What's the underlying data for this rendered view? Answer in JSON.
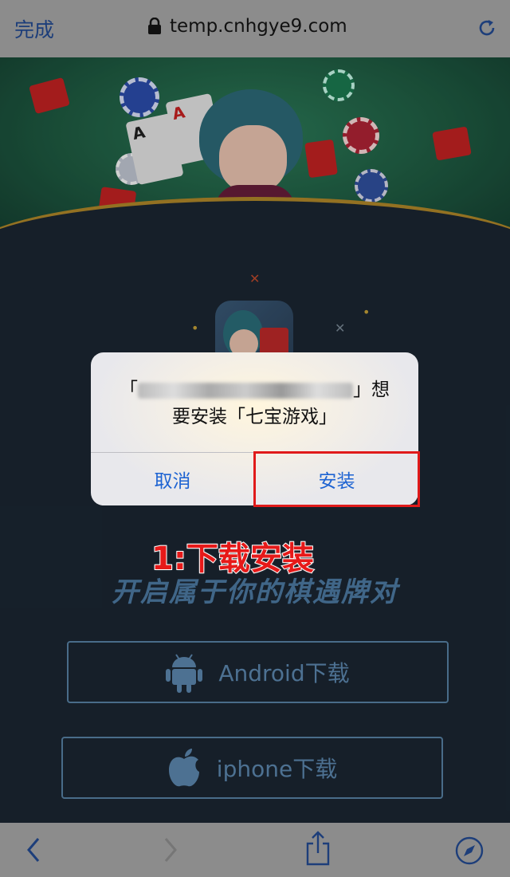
{
  "browser": {
    "done_label": "完成",
    "url": "temp.cnhgye9.com"
  },
  "page": {
    "slogan": "开启属于你的棋遇牌对",
    "android_label": "Android下载",
    "iphone_label": "iphone下载"
  },
  "dialog": {
    "line1_prefix": "「",
    "line1_suffix": "」想",
    "line2": "要安装「七宝游戏」",
    "cancel_label": "取消",
    "install_label": "安装"
  },
  "annotation": {
    "step_label": "1:下载安装"
  },
  "colors": {
    "accent_blue": "#1d63d2",
    "highlight_red": "#e01a1a"
  }
}
